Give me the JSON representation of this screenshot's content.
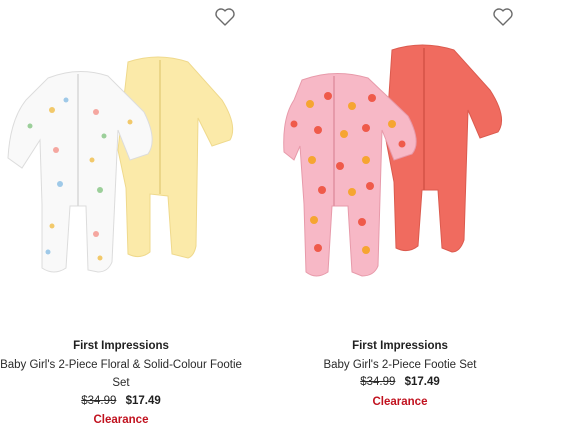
{
  "products": [
    {
      "brand": "First Impressions",
      "title": "Baby Girl's 2-Piece Floral & Solid-Colour Footie Set",
      "original_price": "$34.99",
      "sale_price": "$17.49",
      "badge": "Clearance",
      "image_icon": "floral-footie-set-image",
      "colors": {
        "front": "#f7f7f7",
        "back": "#fbe8a8"
      }
    },
    {
      "brand": "First Impressions",
      "title": "Baby Girl's 2-Piece Footie Set",
      "original_price": "$34.99",
      "sale_price": "$17.49",
      "badge": "Clearance",
      "image_icon": "fruit-footie-set-image",
      "colors": {
        "front": "#f6b7c4",
        "back": "#f06a5e"
      }
    }
  ],
  "favorite_icon": "heart-outline-icon",
  "accent_sale": "#c1121f"
}
